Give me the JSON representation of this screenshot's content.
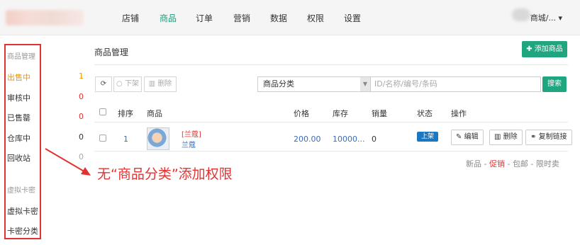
{
  "topnav": {
    "items": [
      "店铺",
      "商品",
      "订单",
      "营销",
      "数据",
      "权限",
      "设置"
    ],
    "active": "商品",
    "user_label": "商城/..."
  },
  "sidebar": {
    "section1": "商品管理",
    "items": [
      {
        "label": "出售中",
        "count": "1"
      },
      {
        "label": "审核中",
        "count": "0"
      },
      {
        "label": "已售罄",
        "count": "0"
      },
      {
        "label": "仓库中",
        "count": "0"
      },
      {
        "label": "回收站",
        "count": "0"
      }
    ],
    "section2": "虚拟卡密",
    "items2": [
      "虚拟卡密",
      "卡密分类"
    ]
  },
  "main": {
    "title": "商品管理",
    "add_button": "添加商品",
    "toolbar": {
      "offshelf": "下架",
      "delete": "删除"
    },
    "category_select": "商品分类",
    "search_placeholder": "ID/名称/编号/条码",
    "search_button": "搜索"
  },
  "table": {
    "headers": [
      "排序",
      "商品",
      "价格",
      "库存",
      "销量",
      "状态",
      "操作"
    ],
    "rows": [
      {
        "sort": "1",
        "tag": "[兰蔻]",
        "name": "兰蔻",
        "price": "200.00",
        "stock": "10000...",
        "sales": "0",
        "status": "上架",
        "actions": [
          "编辑",
          "删除",
          "复制链接"
        ]
      }
    ]
  },
  "filters": [
    "新品",
    "促销",
    "包邮",
    "限时卖"
  ],
  "annotation": "无“商品分类”添加权限",
  "colors": {
    "accent": "#1fa57f",
    "annotation": "#e23333",
    "active_side": "#f29400",
    "badge": "#1a78c2"
  }
}
